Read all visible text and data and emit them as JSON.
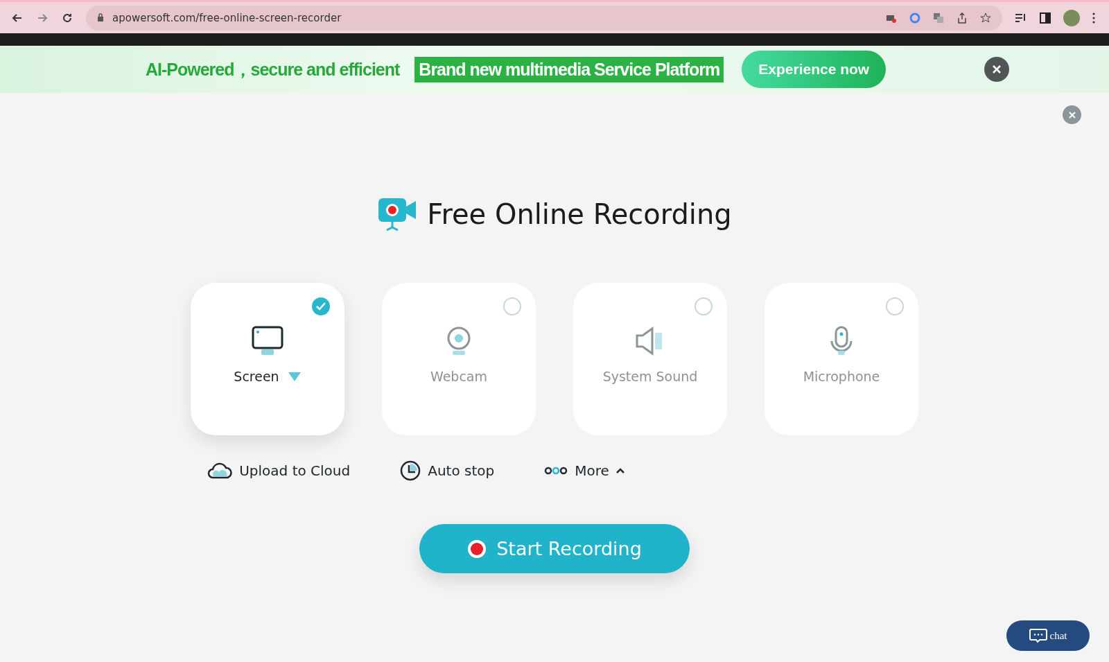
{
  "browser": {
    "url": "apowersoft.com/free-online-screen-recorder"
  },
  "banner": {
    "text": "AI-Powered，secure and efficient",
    "highlight": "Brand new multimedia Service Platform",
    "button": "Experience now"
  },
  "title": "Free Online Recording",
  "sources": [
    {
      "kind": "screen",
      "label": "Screen",
      "selected": true
    },
    {
      "kind": "webcam",
      "label": "Webcam",
      "selected": false
    },
    {
      "kind": "sound",
      "label": "System Sound",
      "selected": false
    },
    {
      "kind": "mic",
      "label": "Microphone",
      "selected": false
    }
  ],
  "options": [
    {
      "kind": "cloud",
      "label": "Upload to Cloud"
    },
    {
      "kind": "timer",
      "label": "Auto stop"
    },
    {
      "kind": "more",
      "label": "More"
    }
  ],
  "start_button": "Start Recording",
  "chat": "chat"
}
